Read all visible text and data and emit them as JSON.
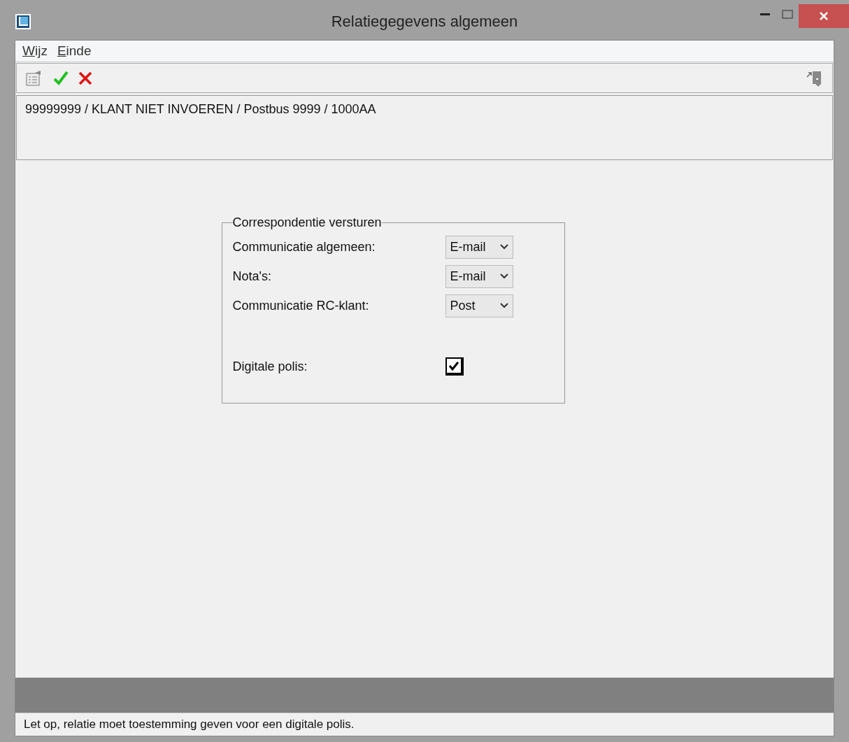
{
  "window": {
    "title": "Relatiegegevens algemeen"
  },
  "menu": [
    {
      "label": "Wijz"
    },
    {
      "label": "Einde"
    }
  ],
  "header": {
    "text": "99999999 / KLANT NIET INVOEREN / Postbus 9999 / 1000AA"
  },
  "group": {
    "title": "Correspondentie versturen",
    "rows": [
      {
        "kind": "select",
        "label": "Communicatie algemeen:",
        "value": "E-mail"
      },
      {
        "kind": "select",
        "label": "Nota's:",
        "value": "E-mail"
      },
      {
        "kind": "select",
        "label": "Communicatie RC-klant:",
        "value": "Post"
      },
      {
        "kind": "checkbox",
        "label": "Digitale polis:",
        "checked": true
      }
    ]
  },
  "status_bar": {
    "text": "Let op, relatie moet toestemming geven voor een digitale polis."
  }
}
